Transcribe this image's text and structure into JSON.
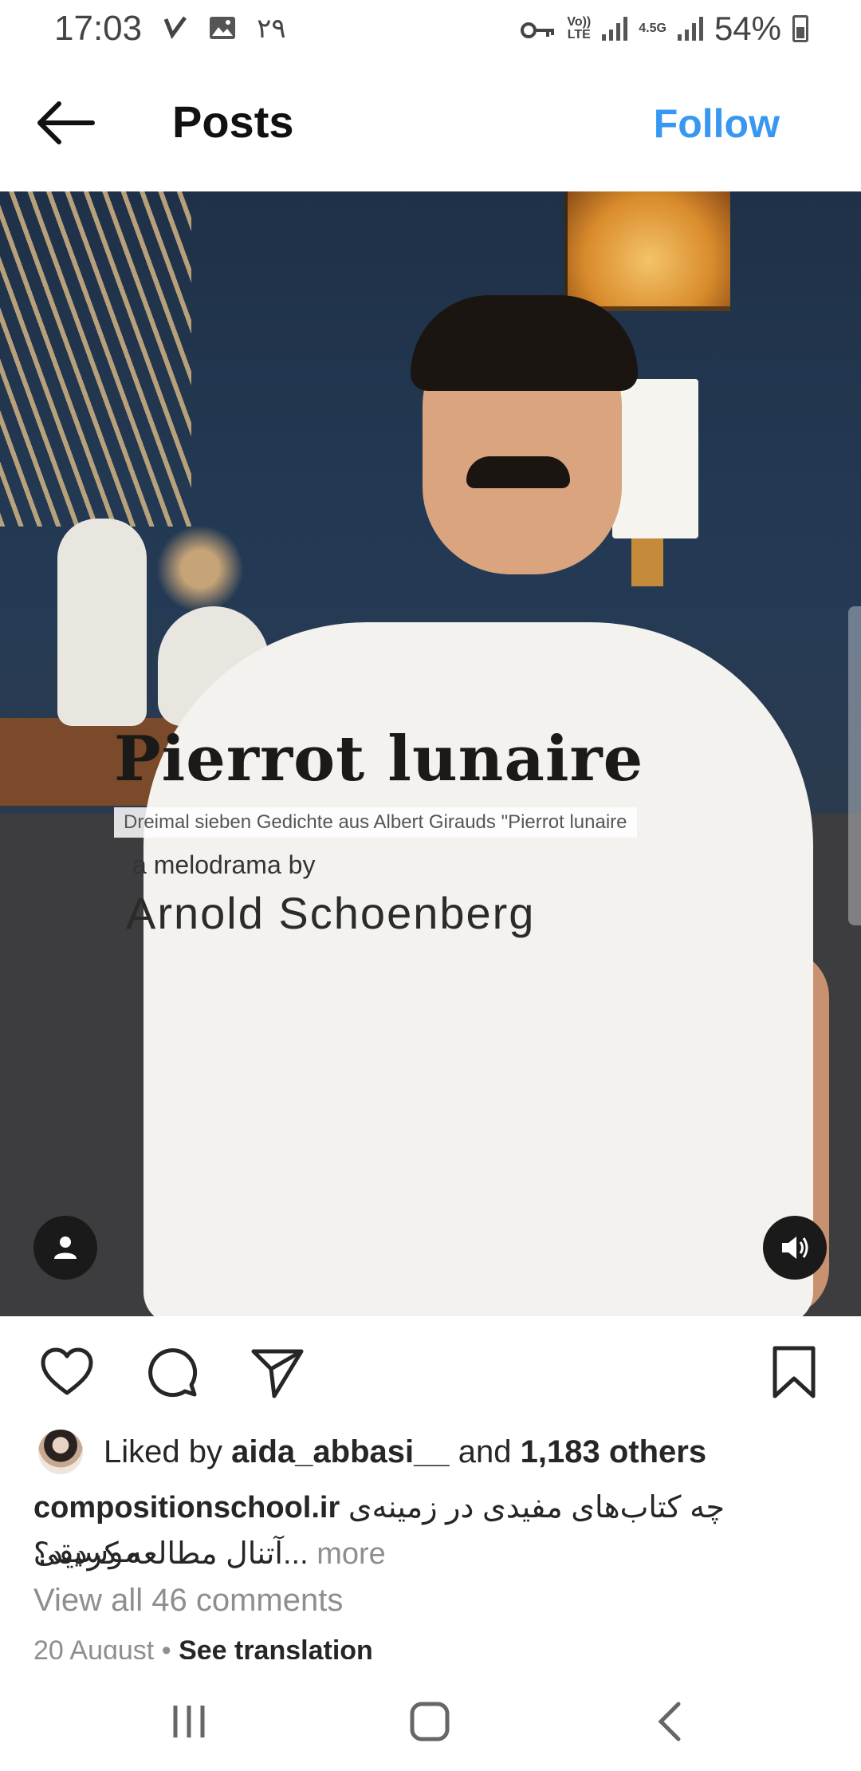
{
  "status_bar": {
    "time": "17:03",
    "notification_count": "۲۹",
    "volte": "Vo))",
    "lte": "LTE",
    "network_type": "4.5G",
    "battery": "54%"
  },
  "header": {
    "title": "Posts",
    "follow_label": "Follow"
  },
  "media": {
    "overlay_title": "Pierrot lunaire",
    "overlay_subtitle": "Dreimal sieben Gedichte aus Albert Girauds \"Pierrot lunaire",
    "overlay_by": "a melodrama by",
    "overlay_composer": "Arnold Schoenberg"
  },
  "likes": {
    "prefix": "Liked by",
    "user": "aida_abbasi__",
    "middle": "and",
    "others": "1,183 others"
  },
  "caption": {
    "username": "compositionschool.ir",
    "text_line1": "چه کتاب‌های مفیدی در زمینه‌ی موسیقی",
    "text_line2": "آتنال مطالعه کردید؟",
    "ellipsis": "...",
    "more": "more"
  },
  "comments": {
    "view_all": "View all 46 comments"
  },
  "meta": {
    "date": "20 August",
    "separator": "•",
    "see_translation": "See translation"
  },
  "colors": {
    "accent": "#3897f0",
    "muted": "#8e8e8e",
    "text": "#262626"
  },
  "icons": [
    "back-arrow-icon",
    "heart-icon",
    "comment-icon",
    "share-icon",
    "bookmark-icon",
    "user-tag-icon",
    "sound-on-icon",
    "recents-icon",
    "home-icon",
    "nav-back-icon"
  ]
}
